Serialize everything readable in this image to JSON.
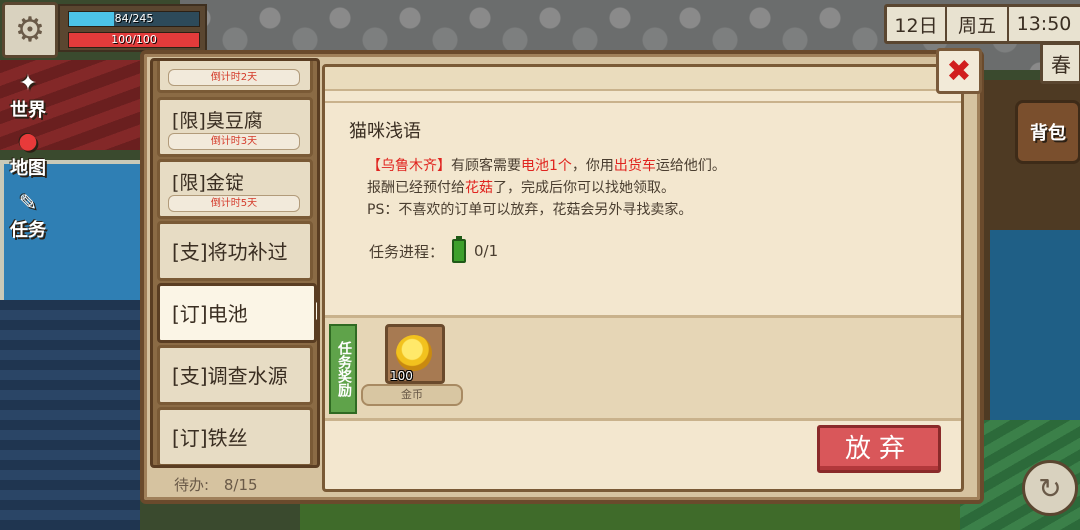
{
  "hud": {
    "stamina_text": "84/245",
    "stamina_ratio": 0.343,
    "health_text": "100/100",
    "health_ratio": 1.0,
    "settings_icon": "gear-icon",
    "date": {
      "day": "12日",
      "weekday": "周五",
      "time": "13:50",
      "season": "春"
    },
    "side_buttons": [
      {
        "label": "世界",
        "icon": "world-icon"
      },
      {
        "label": "地图",
        "icon": "map-pin-icon"
      },
      {
        "label": "任务",
        "icon": "task-icon"
      }
    ],
    "bag_label": "背包"
  },
  "quest_list": {
    "items": [
      {
        "label": "",
        "timer": "倒计时2天"
      },
      {
        "label": "[限]臭豆腐",
        "timer": "倒计时3天"
      },
      {
        "label": "[限]金锭",
        "timer": "倒计时5天"
      },
      {
        "label": "[支]将功补过"
      },
      {
        "label": "[订]电池",
        "active": true
      },
      {
        "label": "[支]调查水源"
      },
      {
        "label": "[订]铁丝"
      }
    ],
    "todo_label": "待办:",
    "todo_value": "8/15"
  },
  "quest_detail": {
    "title": "猫咪浅语",
    "line1": {
      "name": "【乌鲁木齐】",
      "t1": "有顾客需要",
      "item": "电池1个",
      "t2": "，你用",
      "vehicle": "出货车",
      "t3": "运给他们。"
    },
    "line2": {
      "t1": "报酬已经预付给",
      "who": "花菇",
      "t2": "了，完成后你可以找她领取。"
    },
    "line3": "PS：不喜欢的订单可以放弃，花菇会另外寻找卖家。",
    "progress_label": "任务进程：",
    "progress_value": "0/1",
    "reward_tag": "任务奖励",
    "reward": {
      "count": "100",
      "name": "金币",
      "icon": "gold-coin-icon"
    },
    "abandon_label": "放弃"
  },
  "colors": {
    "accent_red": "#e0241f",
    "button_red": "#d9575a",
    "panel_bg": "#f3e7cf"
  }
}
